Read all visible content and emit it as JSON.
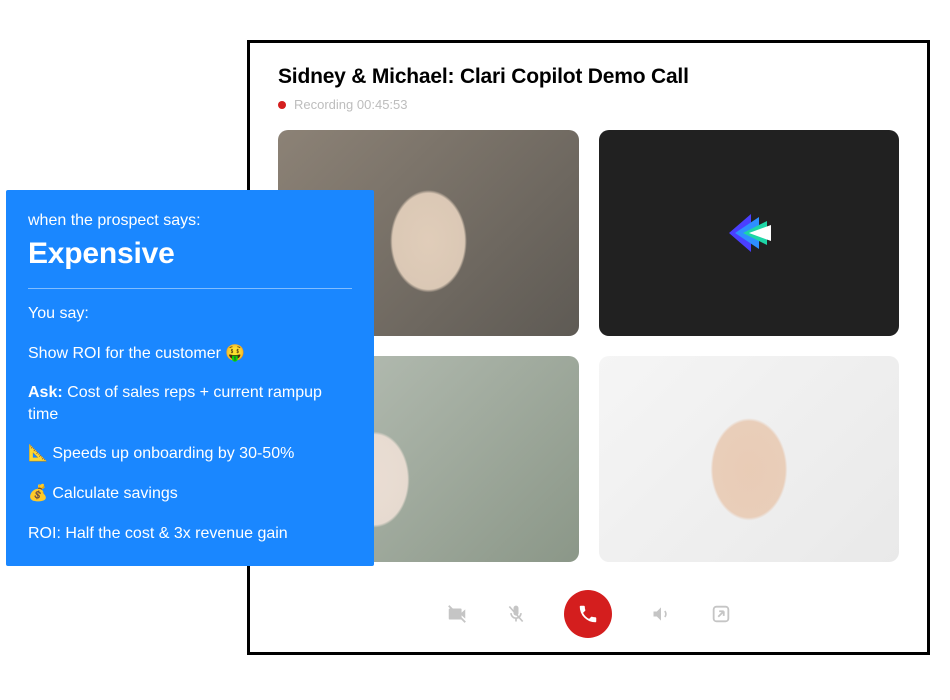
{
  "call": {
    "title": "Sidney & Michael: Clari Copilot Demo Call",
    "recording_label": "Recording",
    "recording_time": "00:45:53"
  },
  "controls": {
    "camera": "camera-off",
    "mic": "mic-off",
    "hangup": "hangup",
    "speaker": "speaker",
    "share": "share"
  },
  "prompt": {
    "intro": "when the prospect says:",
    "keyword": "Expensive",
    "you_say_label": "You say:",
    "line1_text": "Show ROI for the customer 🤑",
    "line2_bold": "Ask:",
    "line2_rest": " Cost of sales reps + current rampup time",
    "line3_text": "📐 Speeds up onboarding by 30-50%",
    "line4_text": "💰 Calculate savings",
    "line5_text": "ROI: Half the cost & 3x revenue gain"
  },
  "colors": {
    "accent_blue": "#1a87ff",
    "record_red": "#d41e1e"
  }
}
